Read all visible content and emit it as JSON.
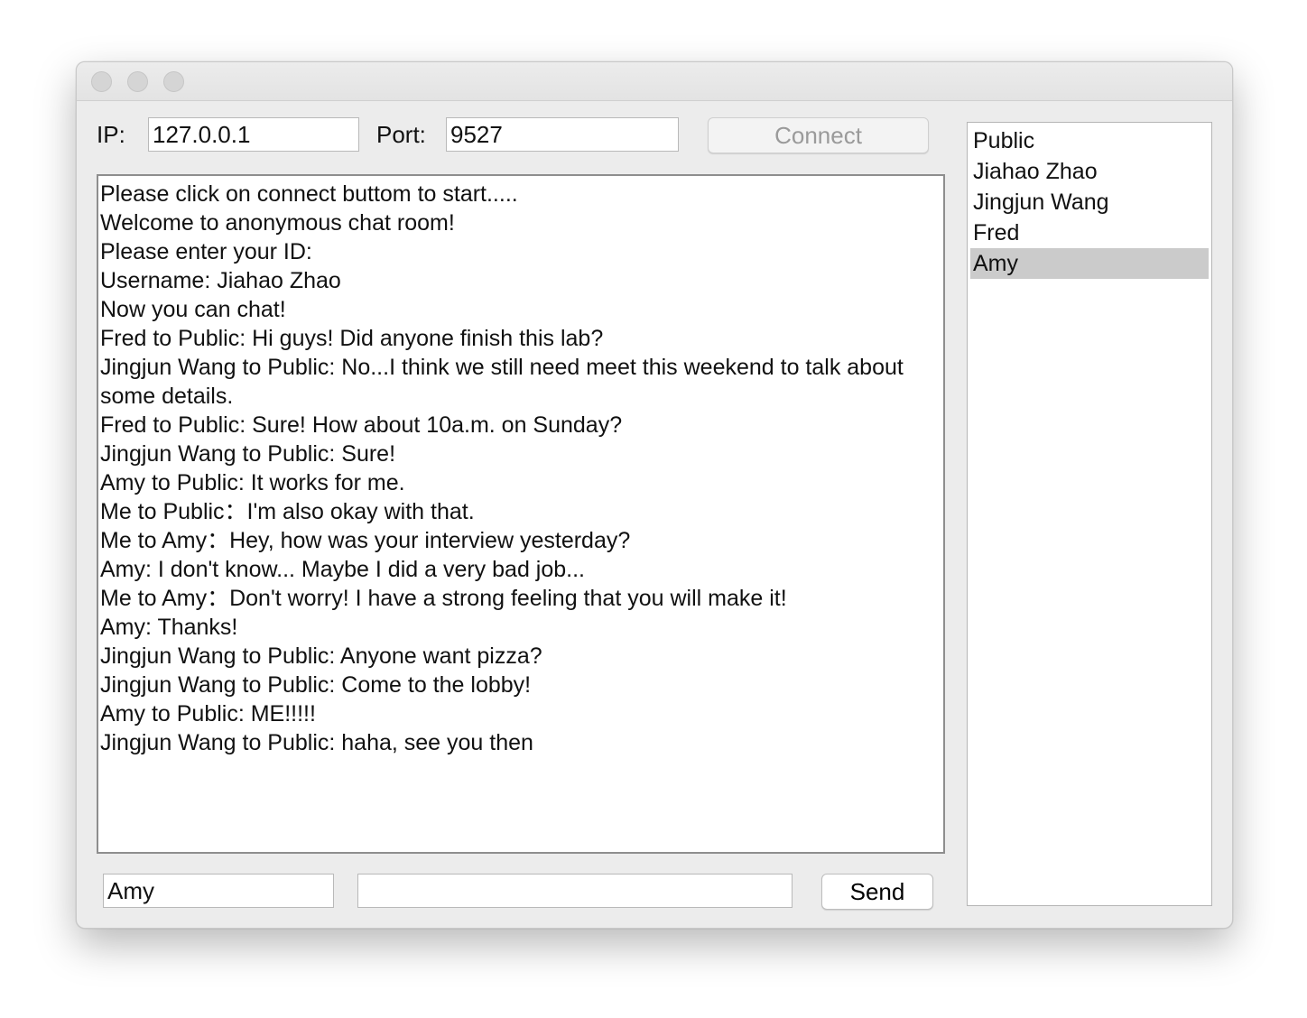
{
  "connection": {
    "ip_label": "IP:",
    "ip_value": "127.0.0.1",
    "port_label": "Port:",
    "port_value": "9527",
    "connect_label": "Connect"
  },
  "chat": {
    "messages": [
      "Please click on connect buttom to start.....",
      "Welcome to anonymous chat room!",
      "Please enter your ID:",
      "Username: Jiahao Zhao",
      "Now you can chat!",
      "Fred to Public: Hi guys! Did anyone finish this lab?",
      "Jingjun Wang to Public: No...I think we still need meet this weekend to talk about some details.",
      "Fred to Public: Sure! How about 10a.m. on Sunday?",
      "Jingjun Wang to Public: Sure!",
      "Amy to Public: It works for me.",
      "Me to Public：I'm also okay with that.",
      "Me to Amy：Hey, how was your interview yesterday?",
      "Amy: I don't know... Maybe I did a very bad job...",
      "Me to Amy：Don't worry! I have a strong feeling that you will make it!",
      "Amy: Thanks!",
      "Jingjun Wang to Public: Anyone want pizza?",
      "Jingjun Wang to Public: Come to the lobby!",
      "Amy to Public: ME!!!!!",
      "Jingjun Wang to Public: haha, see you then"
    ]
  },
  "compose": {
    "recipient_value": "Amy",
    "message_value": "",
    "send_label": "Send"
  },
  "users": {
    "items": [
      "Public",
      "Jiahao Zhao",
      "Jingjun Wang",
      "Fred",
      "Amy"
    ],
    "selected": "Amy"
  }
}
